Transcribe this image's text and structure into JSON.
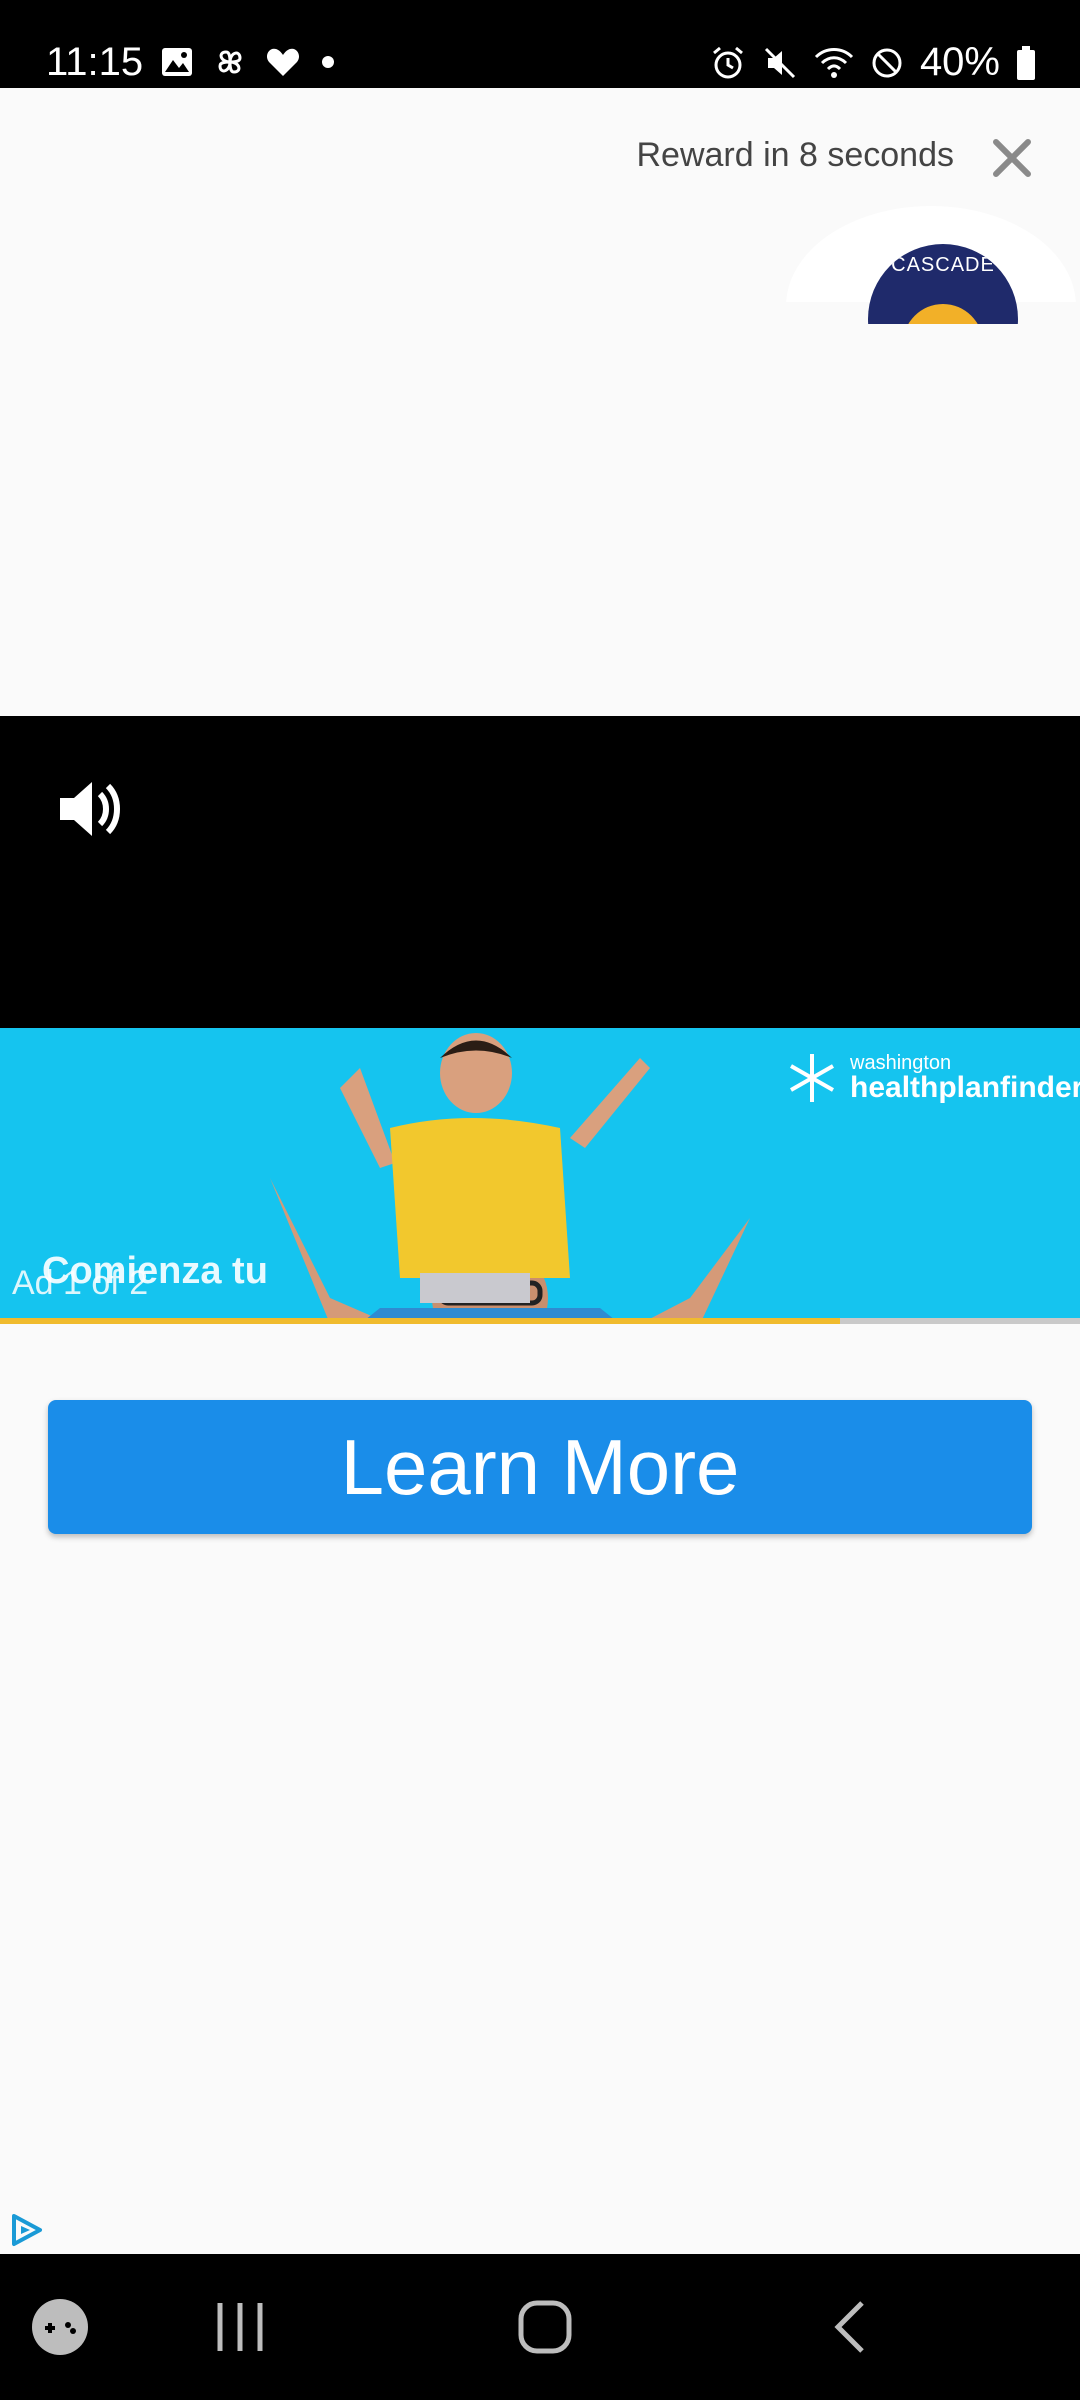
{
  "status_bar": {
    "time": "11:15",
    "battery_percent": "40%",
    "left_icons": [
      "gallery-icon",
      "pinwheel-icon",
      "heart-icon",
      "dot-icon"
    ],
    "right_icons": [
      "alarm-icon",
      "mute-icon",
      "wifi-icon",
      "dnd-icon",
      "battery-icon"
    ]
  },
  "ad_header": {
    "reward_text": "Reward in 8 seconds",
    "close_icon": "close-icon"
  },
  "video": {
    "sound_icon": "speaker-icon"
  },
  "banner": {
    "logo_small": "washington",
    "logo_big": "healthplanfinder",
    "overlay_text": "Comienza tu",
    "ad_counter": "Ad 1 of 2",
    "seal_text": "CASCADE",
    "colors": {
      "background": "#15c4ef",
      "accent_line": "#f0bb2e"
    }
  },
  "cta": {
    "label": "Learn More",
    "color": "#1a8de9"
  },
  "ad_choices_icon": "adchoices-icon",
  "nav_bar": {
    "items": [
      "game-launcher-icon",
      "recents-icon",
      "home-icon",
      "back-icon"
    ]
  }
}
